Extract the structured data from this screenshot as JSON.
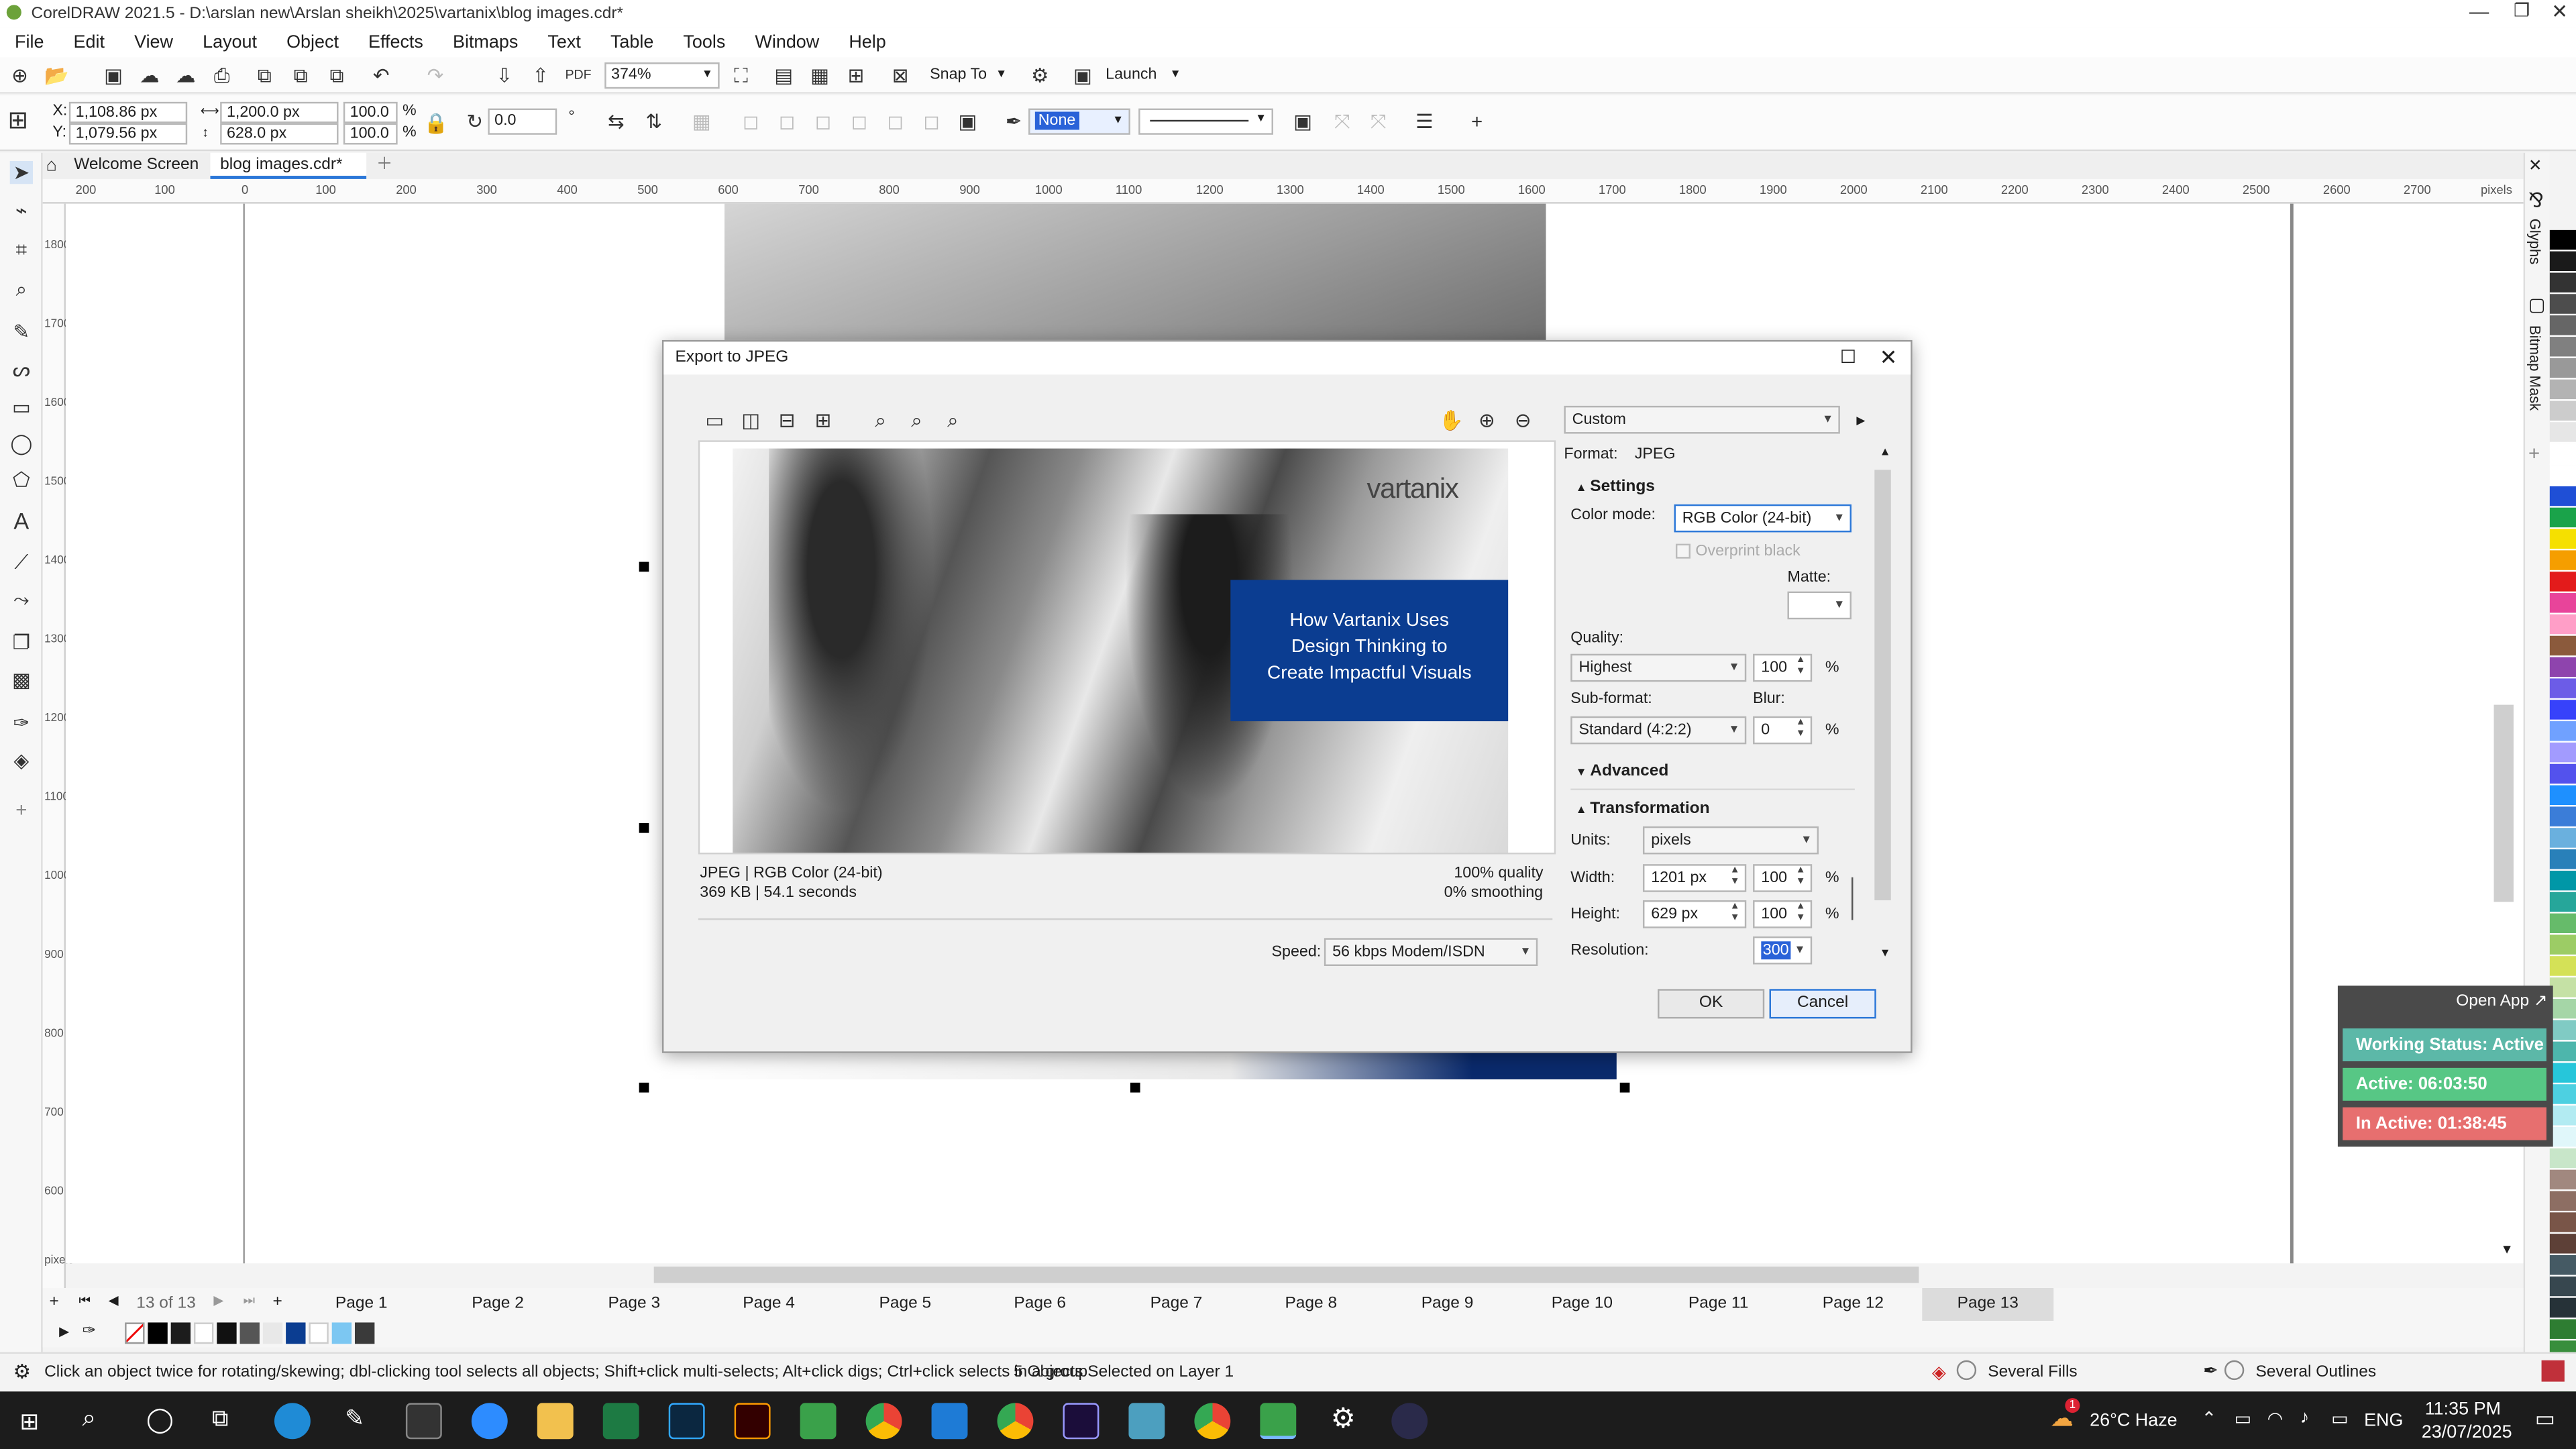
{
  "app": {
    "title": "CorelDRAW 2021.5 - D:\\arslan new\\Arslan sheikh\\2025\\vartanix\\blog images.cdr*",
    "menu": [
      "File",
      "Edit",
      "View",
      "Layout",
      "Object",
      "Effects",
      "Bitmaps",
      "Text",
      "Table",
      "Tools",
      "Window",
      "Help"
    ],
    "zoom": "374%",
    "snap_to": "Snap To",
    "launch": "Launch"
  },
  "property_bar": {
    "x": "1,108.86 px",
    "y": "1,079.56 px",
    "x_label": "X:",
    "y_label": "Y:",
    "width": "1,200.0 px",
    "height": "628.0 px",
    "scale_w": "100.0",
    "scale_h": "100.0",
    "percent": "%",
    "rotation": "0.0",
    "rotation_unit": "°",
    "fill": "None"
  },
  "doc_tabs": [
    "Welcome Screen",
    "blog images.cdr*"
  ],
  "ruler": {
    "h_ticks": [
      "200",
      "100",
      "0",
      "100",
      "200",
      "300",
      "400",
      "500",
      "600",
      "700",
      "800",
      "900",
      "1000",
      "1100",
      "1200",
      "1300",
      "1400",
      "1500",
      "1600",
      "1700",
      "1800",
      "1900",
      "2000",
      "2100",
      "2200",
      "2300",
      "2400",
      "2500",
      "2600",
      "2700"
    ],
    "h_unit": "pixels",
    "v_ticks": [
      "1800",
      "1700",
      "1600",
      "1500",
      "1400",
      "1300",
      "1200",
      "1100",
      "1000",
      "900",
      "800",
      "700",
      "600"
    ],
    "v_unit": "pixels"
  },
  "pages": {
    "counter": "13 of 13",
    "tabs": [
      "Page 1",
      "Page 2",
      "Page 3",
      "Page 4",
      "Page 5",
      "Page 6",
      "Page 7",
      "Page 8",
      "Page 9",
      "Page 10",
      "Page 11",
      "Page 12",
      "Page 13"
    ],
    "active": "Page 13"
  },
  "status": {
    "hint": "Click an object twice for rotating/skewing; dbl-clicking tool selects all objects; Shift+click multi-selects; Alt+click digs; Ctrl+click selects in a group",
    "selection": "5 Objects Selected on Layer 1",
    "fills": "Several Fills",
    "outlines": "Several Outlines"
  },
  "dialog": {
    "title": "Export to JPEG",
    "preset": "Custom",
    "format_label": "Format:",
    "format": "JPEG",
    "settings": "Settings",
    "color_mode_label": "Color mode:",
    "color_mode": "RGB Color (24-bit)",
    "overprint": "Overprint black",
    "matte": "Matte:",
    "quality_label": "Quality:",
    "quality": "Highest",
    "quality_value": "100",
    "subformat_label": "Sub-format:",
    "subformat": "Standard (4:2:2)",
    "blur_label": "Blur:",
    "blur": "0",
    "pct": "%",
    "advanced": "Advanced",
    "transformation": "Transformation",
    "units_label": "Units:",
    "units": "pixels",
    "width_label": "Width:",
    "width": "1201 px",
    "width_pct": "100",
    "height_label": "Height:",
    "height": "629 px",
    "height_pct": "100",
    "resolution_label": "Resolution:",
    "resolution": "300",
    "info_format": "JPEG  |  RGB Color (24-bit)",
    "info_size": "369 KB  |  54.1 seconds",
    "info_quality": "100% quality",
    "info_smoothing": "0% smoothing",
    "speed_label": "Speed:",
    "speed": "56 kbps Modem/ISDN",
    "ok": "OK",
    "cancel": "Cancel",
    "preview": {
      "brand": "vartanix",
      "headline_1": "How Vartanix Uses",
      "headline_2": "Design Thinking to",
      "headline_3": "Create Impactful Visuals"
    }
  },
  "tracker": {
    "open_app": "Open App ↗",
    "working": "Working Status: Active",
    "active": "Active: 06:03:50",
    "inactive": "In Active: 01:38:45"
  },
  "taskbar": {
    "weather": "26°C  Haze",
    "lang": "ENG",
    "time": "11:35 PM",
    "date": "23/07/2025",
    "badge": "1"
  },
  "colors": {
    "accent": "#0b3d91",
    "working": "#52b788",
    "active": "#57c785",
    "inactive": "#e76f6f"
  }
}
